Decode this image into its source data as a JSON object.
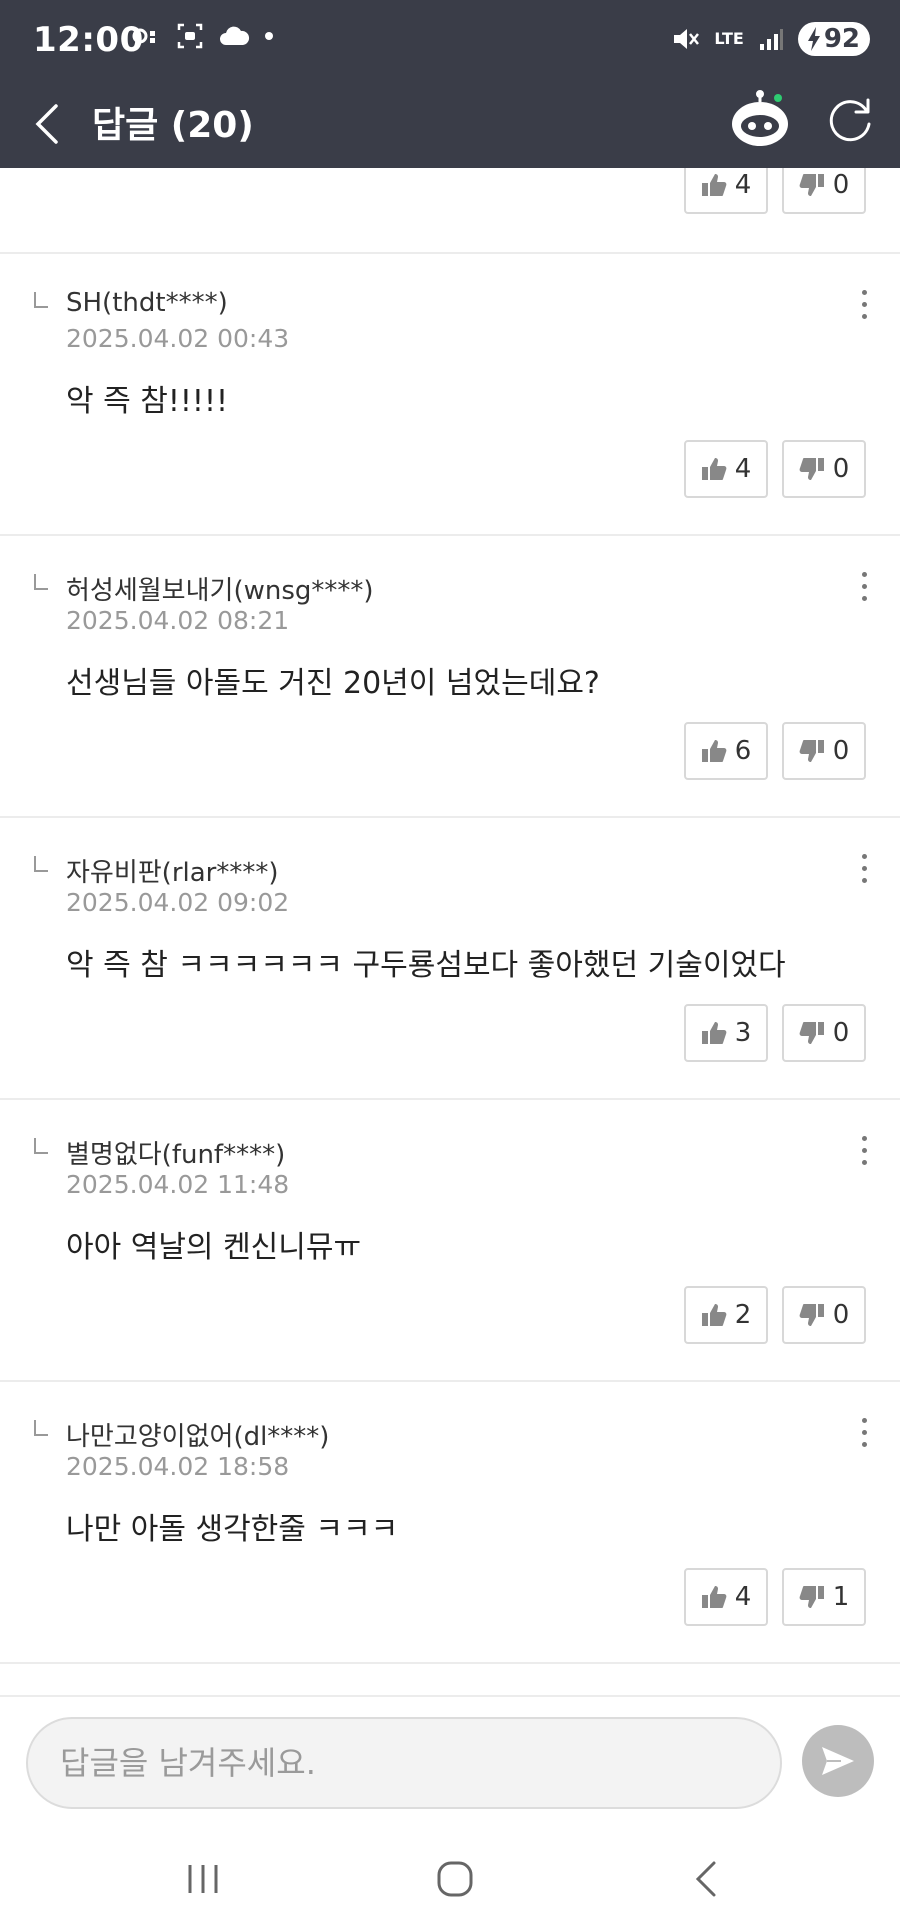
{
  "status": {
    "time": "12:00",
    "battery": "92",
    "network": "LTE"
  },
  "header": {
    "title": "답글 (20)"
  },
  "partial_item": {
    "likes": "4",
    "dislikes": "0"
  },
  "comments": [
    {
      "author": "SH(thdt****)",
      "date": "2025.04.02 00:43",
      "text": "악 즉 참!!!!!",
      "likes": "4",
      "dislikes": "0"
    },
    {
      "author": "허성세월보내기(wnsg****)",
      "date": "2025.04.02 08:21",
      "text": "선생님들 아돌도 거진 20년이 넘었는데요?",
      "likes": "6",
      "dislikes": "0"
    },
    {
      "author": "자유비판(rlar****)",
      "date": "2025.04.02 09:02",
      "text": "악 즉 참 ㅋㅋㅋㅋㅋㅋ 구두룡섬보다 좋아했던 기술이었다",
      "likes": "3",
      "dislikes": "0"
    },
    {
      "author": "별명없다(funf****)",
      "date": "2025.04.02 11:48",
      "text": "아아 역날의 켄신니뮤ㅠ",
      "likes": "2",
      "dislikes": "0"
    },
    {
      "author": "나만고양이없어(dl****)",
      "date": "2025.04.02 18:58",
      "text": "나만 아돌 생각한줄 ㅋㅋㅋ",
      "likes": "4",
      "dislikes": "1"
    }
  ],
  "composer": {
    "placeholder": "답글을 남겨주세요."
  },
  "colors": {
    "header_bg": "#3a3d48",
    "robot_dot": "#2ecc71"
  }
}
